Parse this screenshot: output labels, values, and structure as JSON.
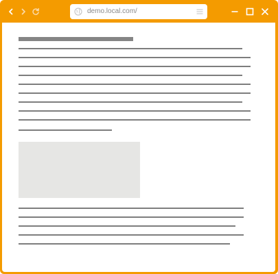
{
  "browser": {
    "url": "demo.local.com/",
    "accent_color": "#f49b00",
    "icons": {
      "back": "chevron-left-icon",
      "forward": "chevron-right-icon",
      "reload": "reload-icon",
      "site": "globe-icon",
      "menu": "hamburger-menu-icon",
      "minimize": "minimize-icon",
      "maximize": "maximize-icon",
      "close": "close-icon"
    }
  },
  "page": {
    "content_color": "#7d7d7d",
    "image_placeholder_color": "#e6e6e4"
  }
}
